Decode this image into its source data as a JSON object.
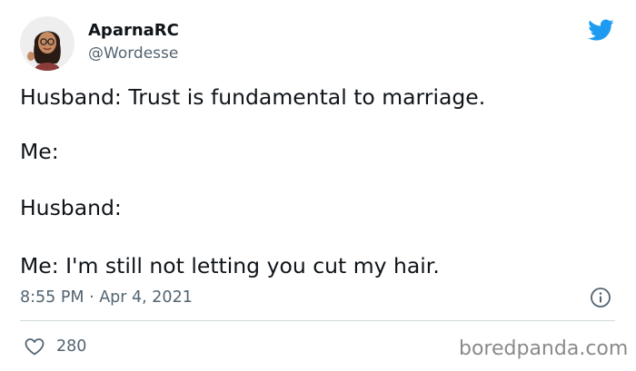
{
  "author": {
    "display_name": "AparnaRC",
    "handle": "@Wordesse"
  },
  "tweet": {
    "lines": [
      "Husband: Trust is fundamental to marriage.",
      "Me:",
      "Husband:",
      "Me: I'm still not letting you cut my hair."
    ],
    "timestamp": "8:55 PM · Apr 4, 2021"
  },
  "actions": {
    "like_count": "280"
  },
  "watermark": "boredpanda.com",
  "icons": {
    "brand": "twitter-bird-icon",
    "info": "info-icon",
    "like": "heart-icon"
  },
  "colors": {
    "twitter_blue": "#1d9bf0",
    "text_primary": "#0f1419",
    "text_secondary": "#536471",
    "divider": "#cfd9de"
  }
}
